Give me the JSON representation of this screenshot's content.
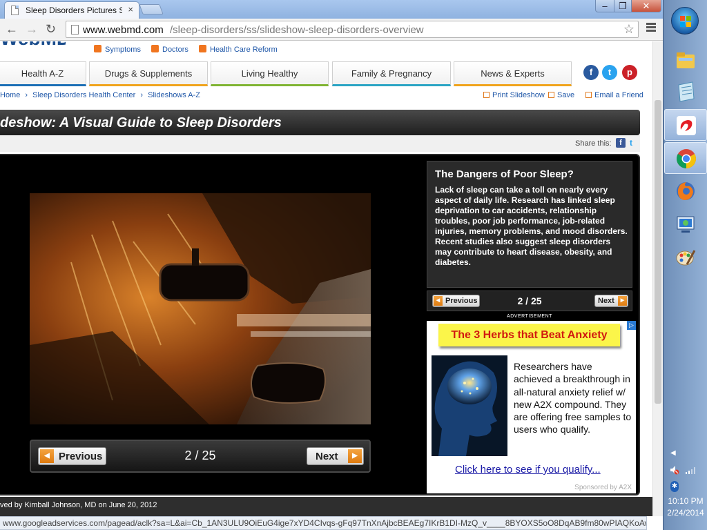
{
  "browser": {
    "tab_title": "Sleep Disorders Pictures Sl",
    "tab_close": "×",
    "url_domain": "www.webmd.com",
    "url_path": "/sleep-disorders/ss/slideshow-sleep-disorders-overview",
    "window_controls": {
      "minimize": "–",
      "maximize": "❐",
      "close": "✕"
    },
    "status_url": "www.googleadservices.com/pagead/aclk?sa=L&ai=Cb_1AN3ULU9OiEuG4ige7xYD4CIvqs-gFq97TnXnAjbcBEAEg7IKrB1DI-MzQ_v____8BYOXS5oO8DqAB9fm80wPIAQKoAwHIA..."
  },
  "utility_nav": [
    {
      "label": "Symptoms",
      "icon": "person-icon"
    },
    {
      "label": "Doctors",
      "icon": "doctor-icon"
    },
    {
      "label": "Health Care Reform",
      "icon": "reform-icon"
    }
  ],
  "main_nav": [
    {
      "label": "Health A-Z"
    },
    {
      "label": "Drugs & Supplements"
    },
    {
      "label": "Living Healthy"
    },
    {
      "label": "Family & Pregnancy"
    },
    {
      "label": "News & Experts"
    }
  ],
  "main_nav_colors": [
    "#1b6fb5",
    "#f0a31b",
    "#7fb432",
    "#2aa4c4",
    "#f0a31b"
  ],
  "social": {
    "facebook": "f",
    "twitter": "t",
    "pinterest": "p",
    "colors": [
      "#2a5a9f",
      "#2aa3ef",
      "#cb2027"
    ]
  },
  "breadcrumb": {
    "home": "Home",
    "sep": "›",
    "center": "Sleep Disorders Health Center",
    "slideshows": "Slideshows A-Z"
  },
  "actions": {
    "print": "Print Slideshow",
    "save": "Save",
    "email": "Email a Friend"
  },
  "slideshow": {
    "title": "deshow: A Visual Guide to Sleep Disorders",
    "share_label": "Share this:",
    "share_fb": "f",
    "share_tw": "t",
    "prev_label": "Previous",
    "next_label": "Next",
    "counter": "2 / 25",
    "slide_heading": "The Dangers of Poor Sleep?",
    "slide_text": "Lack of sleep can take a toll on nearly every aspect of daily life. Research has linked sleep deprivation to car accidents, relationship troubles, poor job performance, job-related injuries, memory problems, and mood disorders. Recent studies also suggest sleep disorders may contribute to heart disease, obesity, and diabetes.",
    "reviewed_text": "ved by Kimball Johnson, MD on June 20, 2012"
  },
  "ad": {
    "label": "ADVERTISEMENT",
    "headline": "The 3 Herbs that Beat Anxiety",
    "body": "Researchers have achieved a breakthrough in all-natural anxiety relief w/ new A2X compound. They are offering free samples to users who qualify.",
    "link": "Click here to see if you qualify...",
    "sponsor": "Sponsored by A2X"
  },
  "taskbar": {
    "items": [
      {
        "icon": "file-explorer-icon"
      },
      {
        "icon": "notepad-icon"
      },
      {
        "icon": "airtel-icon"
      },
      {
        "icon": "chrome-icon",
        "active": true
      },
      {
        "icon": "firefox-icon"
      },
      {
        "icon": "remote-desktop-icon"
      },
      {
        "icon": "paint-icon"
      }
    ],
    "time": "10:10 PM",
    "date": "2/24/2014"
  }
}
